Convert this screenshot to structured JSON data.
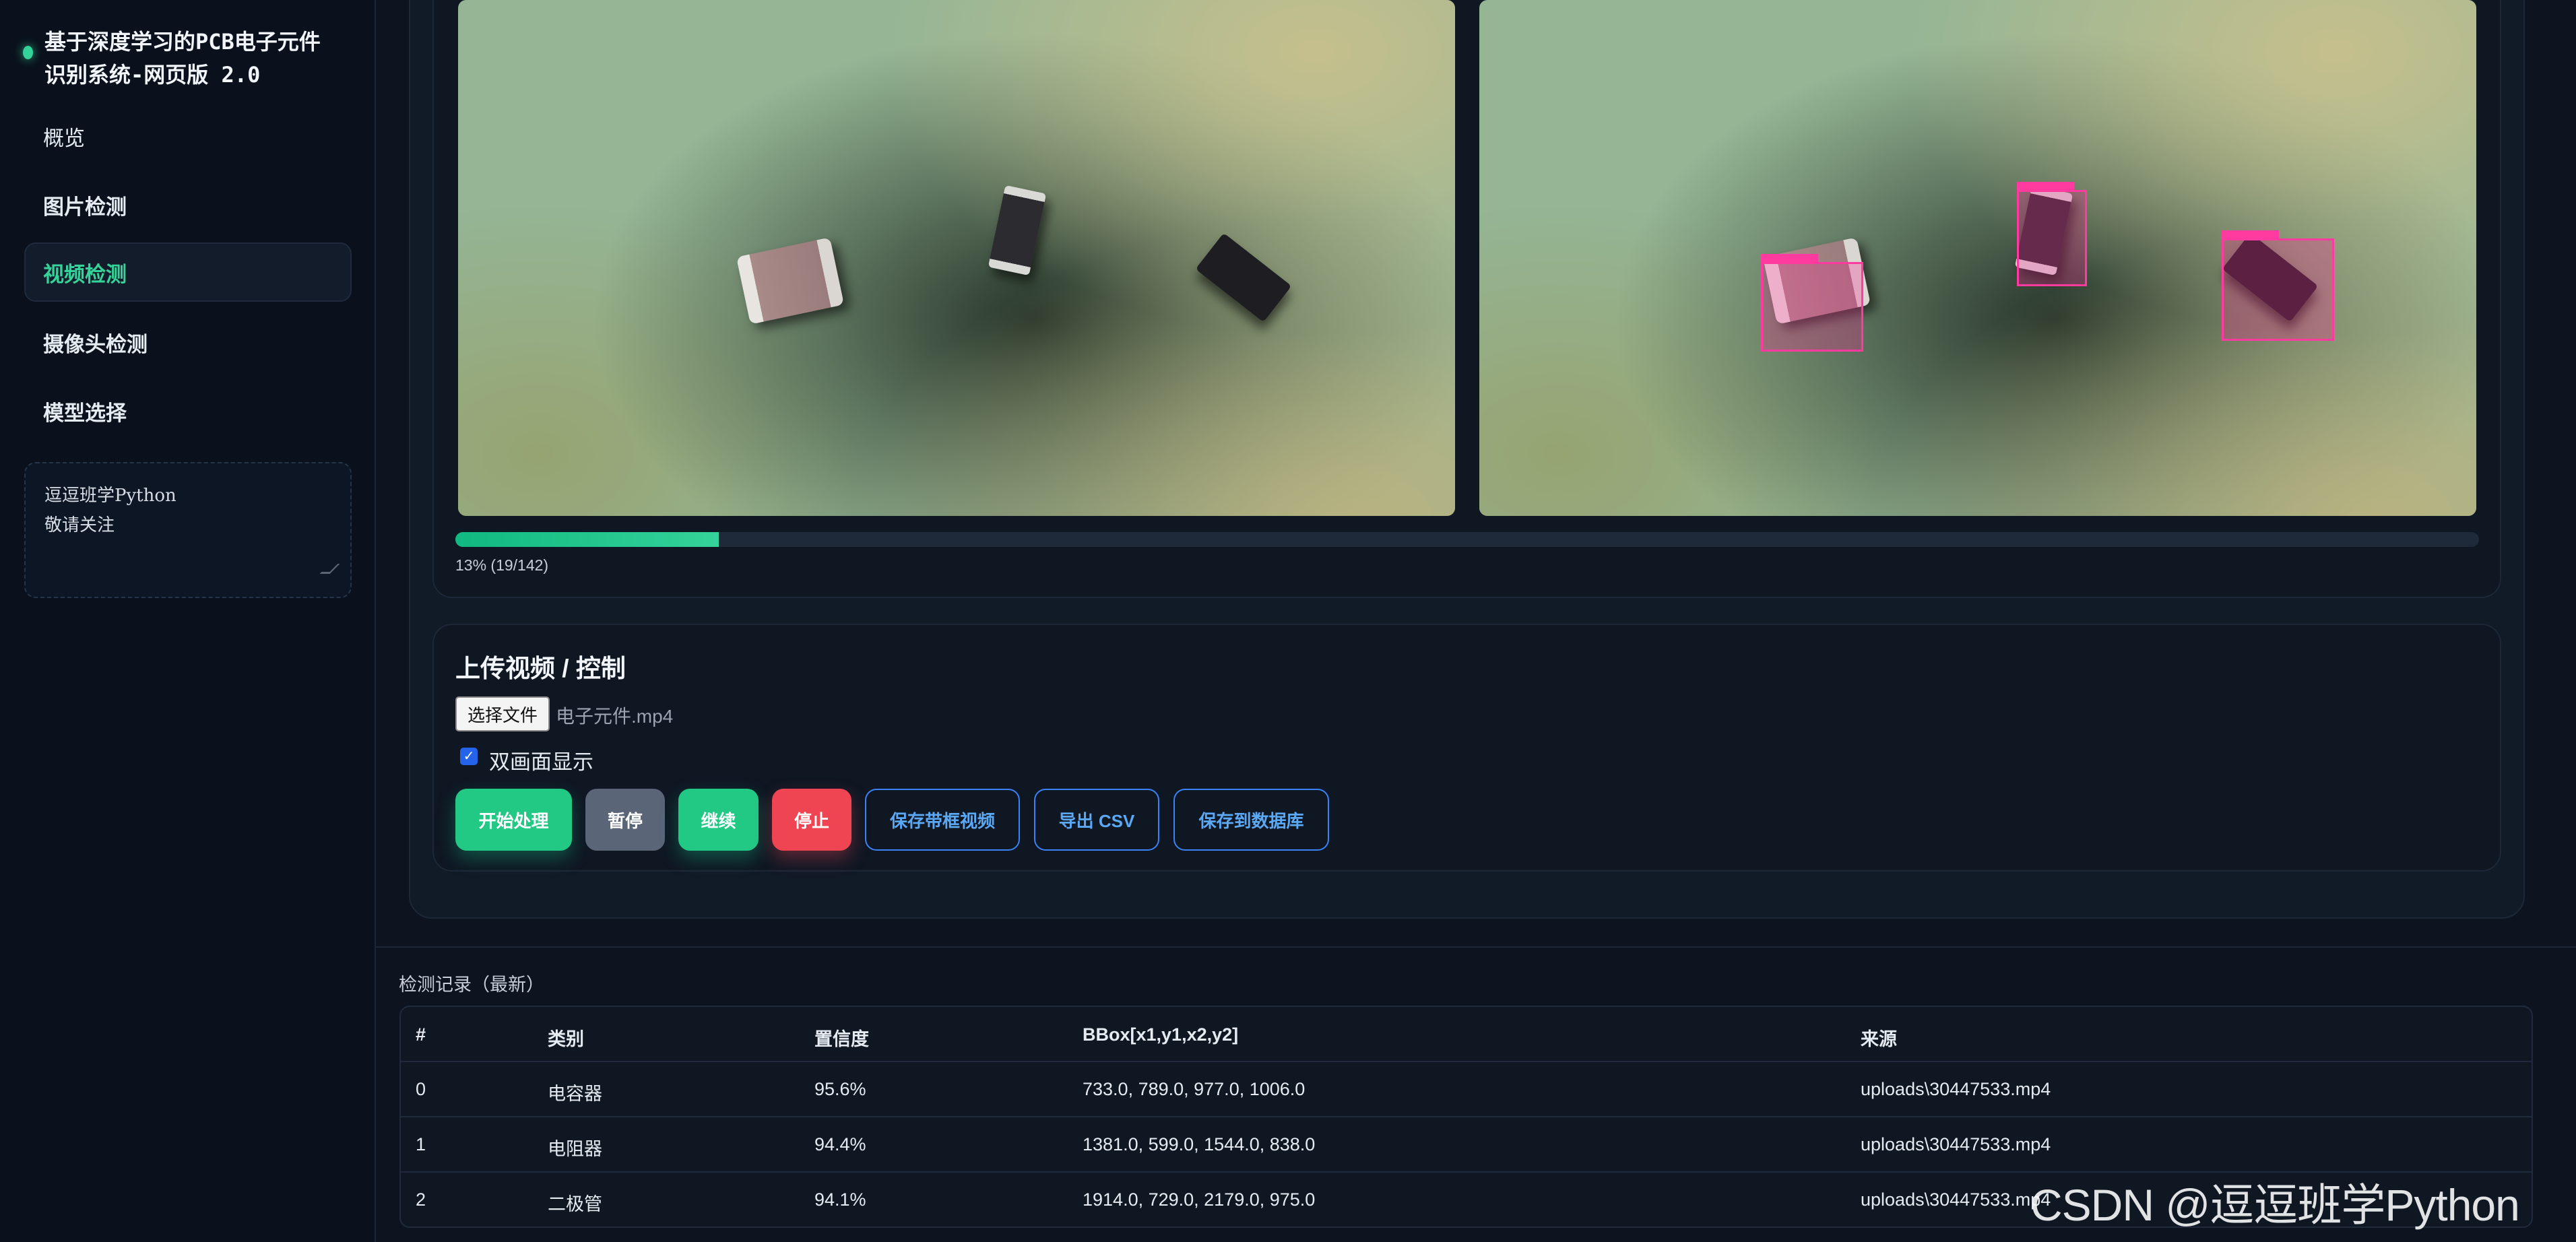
{
  "app": {
    "title": "基于深度学习的PCB电子元件识别系统-网页版 2.0"
  },
  "sidebar": {
    "items": [
      {
        "label": "概览"
      },
      {
        "label": "图片检测"
      },
      {
        "label": "视频检测"
      },
      {
        "label": "摄像头检测"
      },
      {
        "label": "模型选择"
      }
    ],
    "active_item": "视频检测",
    "notes": "逗逗班学Python\n敬请关注"
  },
  "video": {
    "progress_percent": 13,
    "progress_text": "13% (19/142)",
    "detected_components": [
      "电容器",
      "电阻器",
      "二极管"
    ]
  },
  "controls": {
    "title": "上传视频 / 控制",
    "file_button": "选择文件",
    "file_name": "电子元件.mp4",
    "dual_view_label": "双画面显示",
    "dual_view_checked": true,
    "buttons": {
      "start": "开始处理",
      "pause": "暂停",
      "resume": "继续",
      "stop": "停止",
      "save_video": "保存带框视频",
      "export_csv": "导出 CSV",
      "save_db": "保存到数据库"
    }
  },
  "records": {
    "title": "检测记录（最新）",
    "columns": [
      "#",
      "类别",
      "置信度",
      "BBox[x1,y1,x2,y2]",
      "来源"
    ],
    "rows": [
      [
        "0",
        "电容器",
        "95.6%",
        "733.0, 789.0, 977.0, 1006.0",
        "uploads\\30447533.mp4"
      ],
      [
        "1",
        "电阻器",
        "94.4%",
        "1381.0, 599.0, 1544.0, 838.0",
        "uploads\\30447533.mp4"
      ],
      [
        "2",
        "二极管",
        "94.1%",
        "1914.0, 729.0, 2179.0, 975.0",
        "uploads\\30447533.mp4"
      ]
    ]
  },
  "watermark": "CSDN @逗逗班学Python",
  "colors": {
    "accent_green": "#34d399",
    "danger_red": "#ef4452",
    "outline_blue": "#3b82f6",
    "detection_box": "#ff3ba0"
  }
}
